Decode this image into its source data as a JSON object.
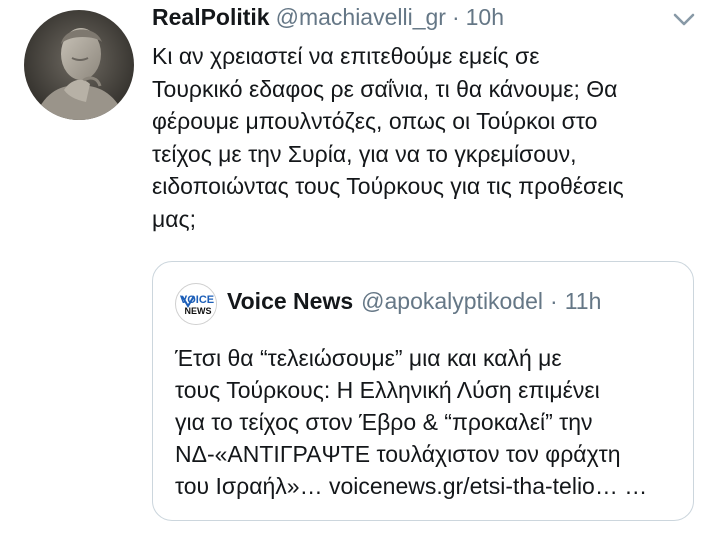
{
  "tweet": {
    "display_name": "RealPolitik",
    "handle": "@machiavelli_gr",
    "separator": "·",
    "time": "10h",
    "text_lines": [
      "Κι αν χρειαστεί να επιτεθούμε εμείς σε",
      "Τουρκικό εδαφος ρε σαΐνια, τι θα κάνουμε; Θα",
      "φέρουμε μπουλντόζες, οπως οι Τούρκοι στο",
      "τείχος με την Συρία, για να το γκρεμίσουν,",
      "ειδοποιώντας τους Τούρκους για τις προθέσεις",
      "μας;"
    ]
  },
  "quote": {
    "display_name": "Voice News",
    "handle": "@apokalyptikodel",
    "separator": "·",
    "time": "11h",
    "avatar_text_top": "VOICE",
    "avatar_text_bottom": "NEWS",
    "text_lines": [
      "Έτσι θα “τελειώσουμε” μια και καλή με",
      "τους Τούρκους: Η Ελληνική Λύση επιμένει",
      "για το τείχος στον Έβρο & “προκαλεί” την",
      "ΝΔ-«ΑΝΤΙΓΡΑΨΤΕ τουλάχιστον τον φράχτη",
      "του Ισραήλ»… voicenews.gr/etsi-tha-telio… …"
    ]
  },
  "icons": {
    "caret": "chevron-down-icon"
  },
  "colors": {
    "text_primary": "#14171a",
    "text_secondary": "#657786",
    "border": "#ccd6dd",
    "voice_blue": "#1d5fb8"
  }
}
